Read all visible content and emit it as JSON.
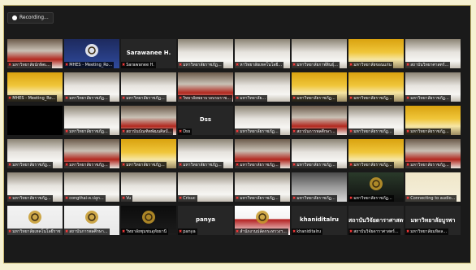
{
  "recording": {
    "label": "Recording...",
    "icon": "record-icon"
  },
  "colors": {
    "background": "#f6f1d2",
    "window": "#1a1a1a",
    "active_border": "#c7d95a",
    "mic_muted": "#ff3a3a"
  },
  "tiles": [
    {
      "label": "มหาวิทยาลัยนักษิตเ...",
      "big_name": "",
      "scene": "room-red"
    },
    {
      "label": "MHES - Meeting_Ro...",
      "big_name": "",
      "scene": "logo-blue"
    },
    {
      "label": "Sarawanee H.",
      "big_name": "Sarawanee H.",
      "scene": "name-only",
      "active": true
    },
    {
      "label": "มหาวิทยาลัยราชภัฏ...",
      "big_name": "",
      "scene": "room-white"
    },
    {
      "label": "หาวิทยาลัยเทคโนโลยี...",
      "big_name": "",
      "scene": "room-white"
    },
    {
      "label": "มหาวิทยาลัยกาฬสินธุ์...",
      "big_name": "",
      "scene": "room-white"
    },
    {
      "label": "มหาวิทยาลัยขอนแก่น",
      "big_name": "",
      "scene": "room-yellow"
    },
    {
      "label": "สถาบันวิทยาศาสตร์...",
      "big_name": "",
      "scene": "room-white"
    },
    {
      "label": "MHES - Meeting_Ro...",
      "big_name": "",
      "scene": "room-yellow"
    },
    {
      "label": "มหาวิทยาลัยราชภัฏ...",
      "big_name": "",
      "scene": "room-white"
    },
    {
      "label": "มหาวิทยาลัยราชภัฏ...",
      "big_name": "",
      "scene": "room-white"
    },
    {
      "label": "วิทยาลัยพยาบาลบรมราช...",
      "big_name": "",
      "scene": "room-red"
    },
    {
      "label": "มหาวิทยาลัย...",
      "big_name": "",
      "scene": "room-white"
    },
    {
      "label": "มหาวิทยาลัยราชภัฏ...",
      "big_name": "",
      "scene": "room-yellow"
    },
    {
      "label": "มหาวิทยาลัยราชภัฏ...",
      "big_name": "",
      "scene": "room-yellow"
    },
    {
      "label": "มหาวิทยาลัยราชภัฏ...",
      "big_name": "",
      "scene": "room-white"
    },
    {
      "label": "",
      "big_name": "",
      "scene": "black"
    },
    {
      "label": "มหาวิทยาลัยราชภัฏ...",
      "big_name": "",
      "scene": "room-white"
    },
    {
      "label": "สถาบันบัณฑิตพัฒนศิลป์...",
      "big_name": "",
      "scene": "room-red"
    },
    {
      "label": "Dss",
      "big_name": "Dss",
      "scene": "name-only"
    },
    {
      "label": "มหาวิทยาลัยราชภัฏ...",
      "big_name": "",
      "scene": "room-white"
    },
    {
      "label": "สถาบันการพลศึกษา...",
      "big_name": "",
      "scene": "room-red"
    },
    {
      "label": "มหาวิทยาลัยราชภัฏ...",
      "big_name": "",
      "scene": "room-white"
    },
    {
      "label": "มหาวิทยาลัยราชภัฏ...",
      "big_name": "",
      "scene": "room-yellow"
    },
    {
      "label": "มหาวิทยาลัยราชภัฏ...",
      "big_name": "",
      "scene": "room-white"
    },
    {
      "label": "มหาวิทยาลัยราชภัฏ...",
      "big_name": "",
      "scene": "room-red"
    },
    {
      "label": "มหาวิทยาลัยราชภัฏ...",
      "big_name": "",
      "scene": "room-yellow"
    },
    {
      "label": "มหาวิทยาลัยราชภัฏ...",
      "big_name": "",
      "scene": "room-white"
    },
    {
      "label": "มหาวิทยาลัยราชภัฏ...",
      "big_name": "",
      "scene": "room-red"
    },
    {
      "label": "มหาวิทยาลัยราชภัฏ...",
      "big_name": "",
      "scene": "room-white"
    },
    {
      "label": "มหาวิทยาลัยราชภัฏ...",
      "big_name": "",
      "scene": "room-yellow"
    },
    {
      "label": "มหาวิทยาลัยราชภัฏ...",
      "big_name": "",
      "scene": "room-red"
    },
    {
      "label": "มหาวิทยาลัยราชภัฏ...",
      "big_name": "",
      "scene": "room-white"
    },
    {
      "label": "congthai-ค.ปลูก...",
      "big_name": "",
      "scene": "room-white"
    },
    {
      "label": "Vu",
      "big_name": "",
      "scene": "room-white"
    },
    {
      "label": "Crisuc",
      "big_name": "",
      "scene": "room-white"
    },
    {
      "label": "มหาวิทยาลัยราชภัฏ...",
      "big_name": "",
      "scene": "room-white"
    },
    {
      "label": "มหาวิทยาลัยราชภัฏ...",
      "big_name": "",
      "scene": "room-grey"
    },
    {
      "label": "มหาวิทยาลัยราชภัฏ...",
      "big_name": "",
      "scene": "emblem-dark"
    },
    {
      "label": "Connecting to audio...",
      "big_name": "",
      "scene": "room-cream"
    },
    {
      "label": "มหาวิทยาลัยเทคโนโลยีราช...",
      "big_name": "",
      "scene": "emblem-white"
    },
    {
      "label": "สถาบันการพลศึกษา...",
      "big_name": "",
      "scene": "emblem-white"
    },
    {
      "label": "วิทยาลัยชุมชนอุทัยธานี",
      "big_name": "",
      "scene": "emblem-black"
    },
    {
      "label": "panya",
      "big_name": "panya",
      "scene": "name-only"
    },
    {
      "label": "สำนักงานปลัดกระทรวงฯ...",
      "big_name": "",
      "scene": "emblem-red"
    },
    {
      "label": "khaniditalru",
      "big_name": "khaniditalru",
      "scene": "name-only"
    },
    {
      "label": "สถาบันวิจัยดาราศาสตร์...",
      "big_name": "สถาบันวิจัยดาราศาสตร",
      "scene": "name-only"
    },
    {
      "label": "มหาวิทยาลัยมหิดล...",
      "big_name": "มหาวิทยาลัยบูรพา",
      "scene": "name-only"
    }
  ]
}
